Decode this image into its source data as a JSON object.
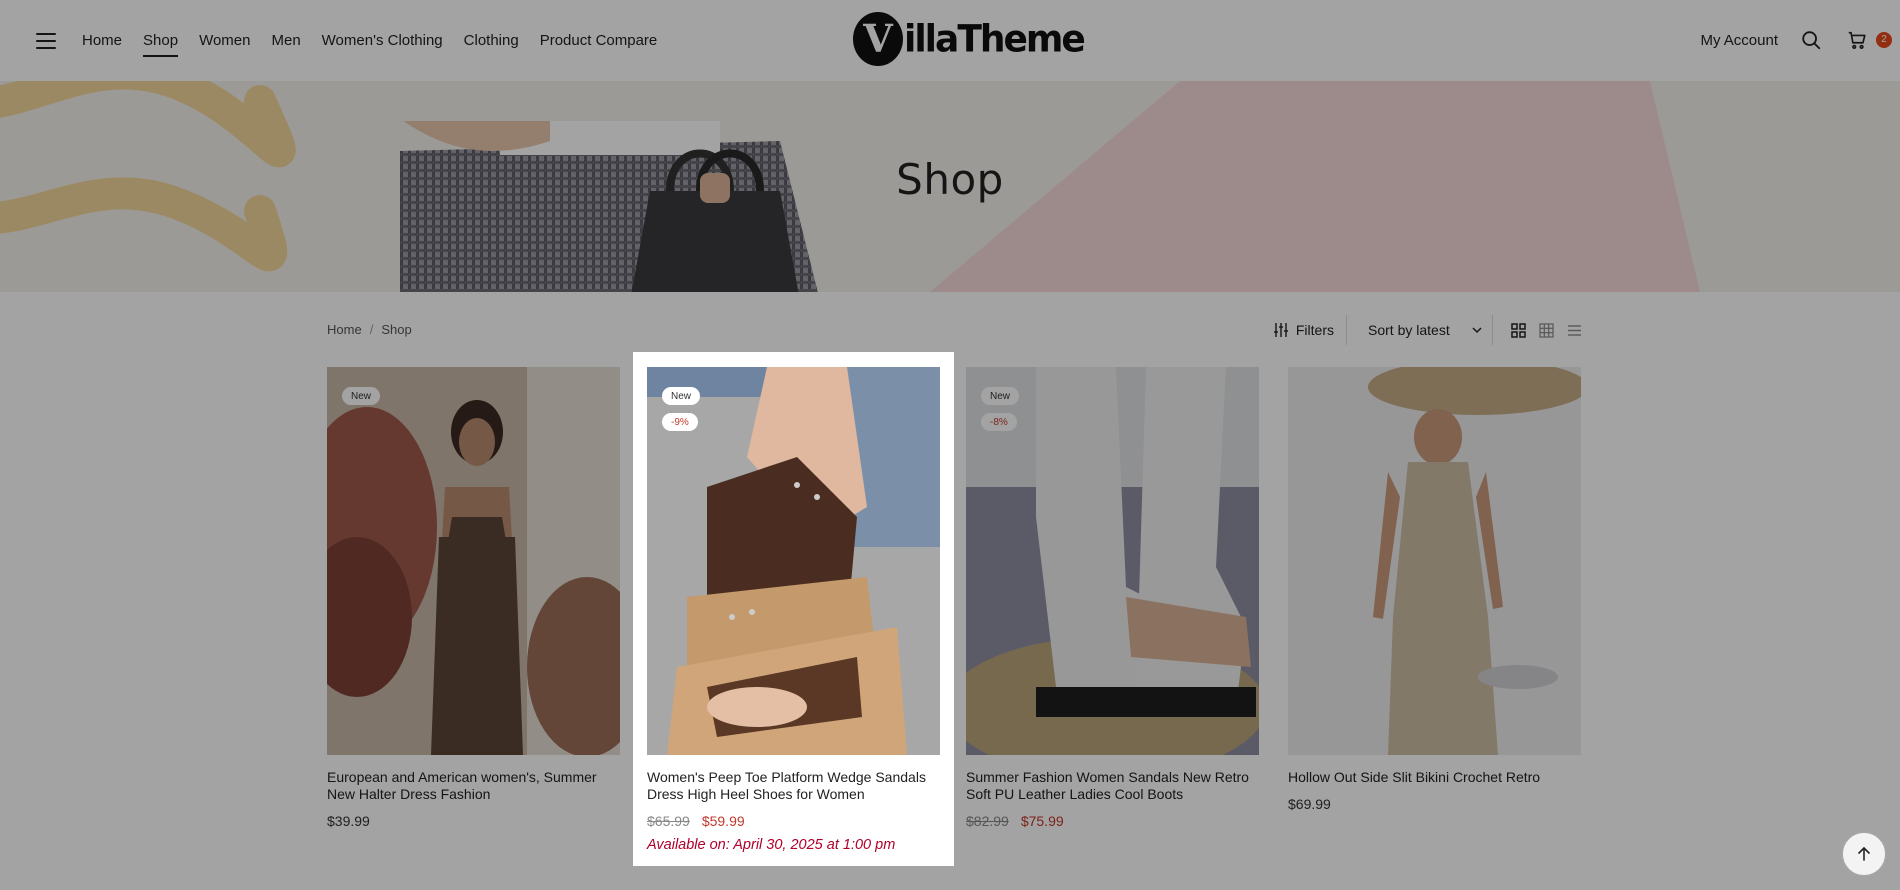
{
  "header": {
    "nav": [
      "Home",
      "Shop",
      "Women",
      "Men",
      "Women's Clothing",
      "Clothing",
      "Product Compare"
    ],
    "active_nav": "Shop",
    "logo_text": "illaTheme",
    "logo_letter": "V",
    "account": "My Account",
    "cart_count": "2"
  },
  "hero": {
    "title": "Shop"
  },
  "breadcrumb": {
    "items": [
      "Home",
      "Shop"
    ],
    "separator": "/"
  },
  "toolbar": {
    "filters_label": "Filters",
    "sort_value": "Sort by latest",
    "views": [
      "grid-2-icon",
      "grid-3-icon",
      "list-icon"
    ]
  },
  "products": [
    {
      "title": "European and American women's, Summer New Halter Dress Fashion",
      "badges": [
        "New"
      ],
      "price": "$39.99"
    },
    {
      "title": "Women's Peep Toe Platform Wedge Sandals Dress High Heel Shoes for Women",
      "badges": [
        "New",
        "-9%"
      ],
      "old_price": "$65.99",
      "new_price": "$59.99",
      "availability": "Available on: April 30, 2025 at 1:00 pm"
    },
    {
      "title": "Summer Fashion Women Sandals New Retro Soft PU Leather Ladies Cool Boots",
      "badges": [
        "New",
        "-8%"
      ],
      "old_price": "$82.99",
      "new_price": "$75.99"
    },
    {
      "title": "Hollow Out Side Slit Bikini Crochet Retro",
      "badges": [],
      "price": "$69.99"
    }
  ],
  "colors": {
    "sale": "#c0392b",
    "availability": "#b0002a",
    "cart_badge": "#e64a19"
  }
}
